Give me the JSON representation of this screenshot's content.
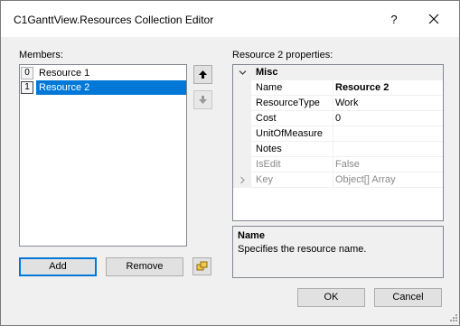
{
  "window": {
    "title": "C1GanttView.Resources Collection Editor",
    "help_label": "?"
  },
  "members": {
    "label": "Members:",
    "items": [
      {
        "index": "0",
        "name": "Resource 1",
        "selected": false
      },
      {
        "index": "1",
        "name": "Resource 2",
        "selected": true
      }
    ],
    "add_label": "Add",
    "remove_label": "Remove"
  },
  "properties": {
    "label": "Resource 2 properties:",
    "category": "Misc",
    "rows": [
      {
        "name": "Name",
        "value": "Resource 2",
        "bold": true,
        "readonly": false,
        "expandable": false
      },
      {
        "name": "ResourceType",
        "value": "Work",
        "bold": false,
        "readonly": false,
        "expandable": false
      },
      {
        "name": "Cost",
        "value": "0",
        "bold": false,
        "readonly": false,
        "expandable": false
      },
      {
        "name": "UnitOfMeasure",
        "value": "",
        "bold": false,
        "readonly": false,
        "expandable": false
      },
      {
        "name": "Notes",
        "value": "",
        "bold": false,
        "readonly": false,
        "expandable": false
      },
      {
        "name": "IsEdit",
        "value": "False",
        "bold": false,
        "readonly": true,
        "expandable": false
      },
      {
        "name": "Key",
        "value": "Object[] Array",
        "bold": false,
        "readonly": true,
        "expandable": true
      }
    ]
  },
  "description": {
    "title": "Name",
    "text": "Specifies the resource name."
  },
  "footer": {
    "ok_label": "OK",
    "cancel_label": "Cancel"
  },
  "colors": {
    "selection": "#0078d7",
    "dialog_bg": "#f0f0f0",
    "readonly_text": "#8a8a8a"
  }
}
